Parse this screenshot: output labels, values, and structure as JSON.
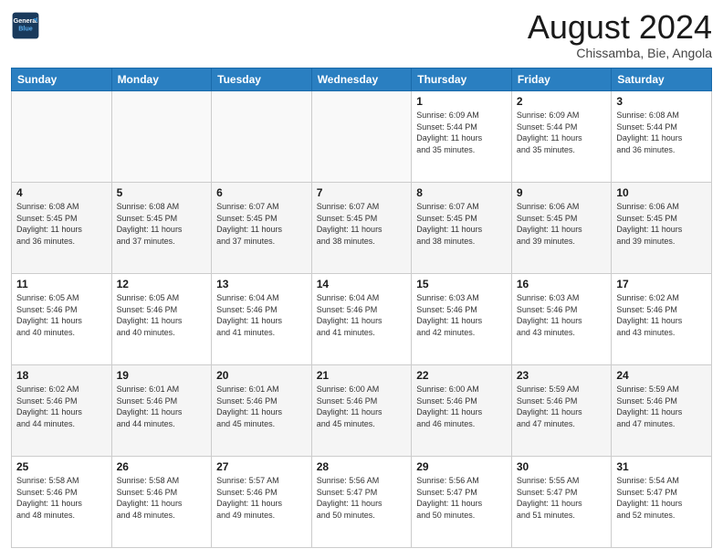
{
  "header": {
    "logo_line1": "General",
    "logo_line2": "Blue",
    "month_title": "August 2024",
    "location": "Chissamba, Bie, Angola"
  },
  "days_of_week": [
    "Sunday",
    "Monday",
    "Tuesday",
    "Wednesday",
    "Thursday",
    "Friday",
    "Saturday"
  ],
  "weeks": [
    [
      {
        "day": "",
        "info": ""
      },
      {
        "day": "",
        "info": ""
      },
      {
        "day": "",
        "info": ""
      },
      {
        "day": "",
        "info": ""
      },
      {
        "day": "1",
        "info": "Sunrise: 6:09 AM\nSunset: 5:44 PM\nDaylight: 11 hours\nand 35 minutes."
      },
      {
        "day": "2",
        "info": "Sunrise: 6:09 AM\nSunset: 5:44 PM\nDaylight: 11 hours\nand 35 minutes."
      },
      {
        "day": "3",
        "info": "Sunrise: 6:08 AM\nSunset: 5:44 PM\nDaylight: 11 hours\nand 36 minutes."
      }
    ],
    [
      {
        "day": "4",
        "info": "Sunrise: 6:08 AM\nSunset: 5:45 PM\nDaylight: 11 hours\nand 36 minutes."
      },
      {
        "day": "5",
        "info": "Sunrise: 6:08 AM\nSunset: 5:45 PM\nDaylight: 11 hours\nand 37 minutes."
      },
      {
        "day": "6",
        "info": "Sunrise: 6:07 AM\nSunset: 5:45 PM\nDaylight: 11 hours\nand 37 minutes."
      },
      {
        "day": "7",
        "info": "Sunrise: 6:07 AM\nSunset: 5:45 PM\nDaylight: 11 hours\nand 38 minutes."
      },
      {
        "day": "8",
        "info": "Sunrise: 6:07 AM\nSunset: 5:45 PM\nDaylight: 11 hours\nand 38 minutes."
      },
      {
        "day": "9",
        "info": "Sunrise: 6:06 AM\nSunset: 5:45 PM\nDaylight: 11 hours\nand 39 minutes."
      },
      {
        "day": "10",
        "info": "Sunrise: 6:06 AM\nSunset: 5:45 PM\nDaylight: 11 hours\nand 39 minutes."
      }
    ],
    [
      {
        "day": "11",
        "info": "Sunrise: 6:05 AM\nSunset: 5:46 PM\nDaylight: 11 hours\nand 40 minutes."
      },
      {
        "day": "12",
        "info": "Sunrise: 6:05 AM\nSunset: 5:46 PM\nDaylight: 11 hours\nand 40 minutes."
      },
      {
        "day": "13",
        "info": "Sunrise: 6:04 AM\nSunset: 5:46 PM\nDaylight: 11 hours\nand 41 minutes."
      },
      {
        "day": "14",
        "info": "Sunrise: 6:04 AM\nSunset: 5:46 PM\nDaylight: 11 hours\nand 41 minutes."
      },
      {
        "day": "15",
        "info": "Sunrise: 6:03 AM\nSunset: 5:46 PM\nDaylight: 11 hours\nand 42 minutes."
      },
      {
        "day": "16",
        "info": "Sunrise: 6:03 AM\nSunset: 5:46 PM\nDaylight: 11 hours\nand 43 minutes."
      },
      {
        "day": "17",
        "info": "Sunrise: 6:02 AM\nSunset: 5:46 PM\nDaylight: 11 hours\nand 43 minutes."
      }
    ],
    [
      {
        "day": "18",
        "info": "Sunrise: 6:02 AM\nSunset: 5:46 PM\nDaylight: 11 hours\nand 44 minutes."
      },
      {
        "day": "19",
        "info": "Sunrise: 6:01 AM\nSunset: 5:46 PM\nDaylight: 11 hours\nand 44 minutes."
      },
      {
        "day": "20",
        "info": "Sunrise: 6:01 AM\nSunset: 5:46 PM\nDaylight: 11 hours\nand 45 minutes."
      },
      {
        "day": "21",
        "info": "Sunrise: 6:00 AM\nSunset: 5:46 PM\nDaylight: 11 hours\nand 45 minutes."
      },
      {
        "day": "22",
        "info": "Sunrise: 6:00 AM\nSunset: 5:46 PM\nDaylight: 11 hours\nand 46 minutes."
      },
      {
        "day": "23",
        "info": "Sunrise: 5:59 AM\nSunset: 5:46 PM\nDaylight: 11 hours\nand 47 minutes."
      },
      {
        "day": "24",
        "info": "Sunrise: 5:59 AM\nSunset: 5:46 PM\nDaylight: 11 hours\nand 47 minutes."
      }
    ],
    [
      {
        "day": "25",
        "info": "Sunrise: 5:58 AM\nSunset: 5:46 PM\nDaylight: 11 hours\nand 48 minutes."
      },
      {
        "day": "26",
        "info": "Sunrise: 5:58 AM\nSunset: 5:46 PM\nDaylight: 11 hours\nand 48 minutes."
      },
      {
        "day": "27",
        "info": "Sunrise: 5:57 AM\nSunset: 5:46 PM\nDaylight: 11 hours\nand 49 minutes."
      },
      {
        "day": "28",
        "info": "Sunrise: 5:56 AM\nSunset: 5:47 PM\nDaylight: 11 hours\nand 50 minutes."
      },
      {
        "day": "29",
        "info": "Sunrise: 5:56 AM\nSunset: 5:47 PM\nDaylight: 11 hours\nand 50 minutes."
      },
      {
        "day": "30",
        "info": "Sunrise: 5:55 AM\nSunset: 5:47 PM\nDaylight: 11 hours\nand 51 minutes."
      },
      {
        "day": "31",
        "info": "Sunrise: 5:54 AM\nSunset: 5:47 PM\nDaylight: 11 hours\nand 52 minutes."
      }
    ]
  ]
}
